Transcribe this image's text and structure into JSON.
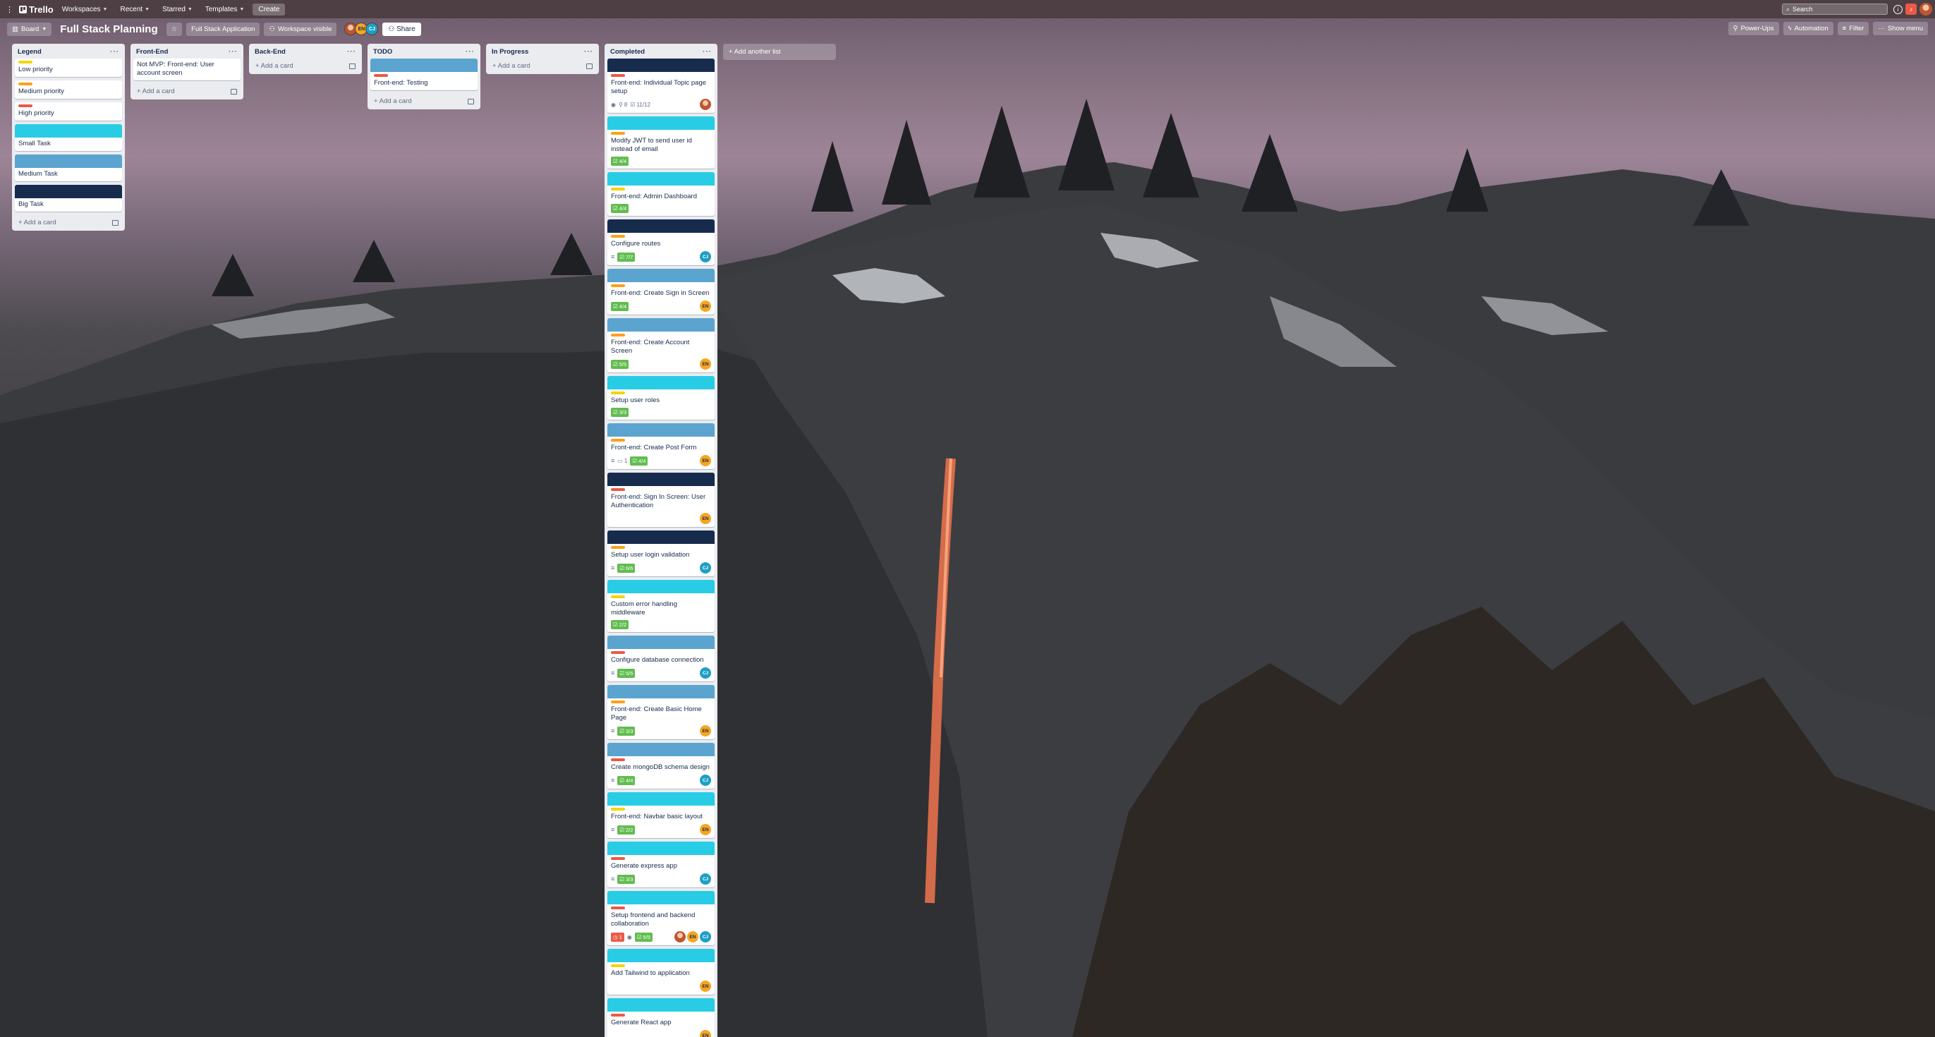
{
  "topbar": {
    "app_name": "Trello",
    "workspaces": "Workspaces",
    "recent": "Recent",
    "starred": "Starred",
    "templates": "Templates",
    "create": "Create",
    "search_placeholder": "Search"
  },
  "boardbar": {
    "view": "Board",
    "title": "Full Stack Planning",
    "workspace": "Full Stack Application",
    "visibility": "Workspace visible",
    "share": "Share",
    "power_ups": "Power-Ups",
    "automation": "Automation",
    "filter": "Filter",
    "show_menu": "Show menu",
    "members": [
      "photo",
      "EN",
      "CJ"
    ]
  },
  "colors": {
    "yellow": "#f2d600",
    "orange": "#ff9f1a",
    "red": "#eb5a46",
    "sky": "#29cce5",
    "blue": "#5ba4cf",
    "navy": "#172b4d",
    "green": "#61bd4f"
  },
  "add_card": "Add a card",
  "add_list": "Add another list",
  "lists": [
    {
      "name": "Legend",
      "cards": [
        {
          "label": "yellow",
          "title": "Low priority"
        },
        {
          "label": "orange",
          "title": "Medium priority"
        },
        {
          "label": "red",
          "title": "High priority"
        },
        {
          "cover": "sky",
          "title": "Small Task"
        },
        {
          "cover": "blue",
          "title": "Medium Task"
        },
        {
          "cover": "navy",
          "title": "Big Task"
        }
      ]
    },
    {
      "name": "Front-End",
      "cards": [
        {
          "title": "Not MVP: Front-end: User account screen"
        }
      ]
    },
    {
      "name": "Back-End",
      "cards": []
    },
    {
      "name": "TODO",
      "cards": [
        {
          "cover": "blue",
          "label": "red",
          "title": "Front-end: Testing"
        }
      ]
    },
    {
      "name": "In Progress",
      "cards": []
    },
    {
      "name": "Completed",
      "cards": [
        {
          "cover": "navy",
          "label": "red",
          "title": "Front-end: Individual Topic page setup",
          "watch": true,
          "attach": "8",
          "check": "11/12",
          "check_plain": true,
          "members": [
            "photo"
          ]
        },
        {
          "cover": "sky",
          "label": "orange",
          "title": "Modify JWT to send user id instead of email",
          "check": "4/4"
        },
        {
          "cover": "sky",
          "label": "yellow",
          "title": "Front-end: Admin Dashboard",
          "check": "4/4"
        },
        {
          "cover": "navy",
          "label": "orange",
          "title": "Configure routes",
          "desc": true,
          "check": "7/7",
          "members": [
            "CJ"
          ]
        },
        {
          "cover": "blue",
          "label": "orange",
          "title": "Front-end: Create Sign in Screen",
          "check": "4/4",
          "members": [
            "EN"
          ]
        },
        {
          "cover": "blue",
          "label": "orange",
          "title": "Front-end: Create Account Screen",
          "check": "5/5",
          "members": [
            "EN"
          ]
        },
        {
          "cover": "sky",
          "label": "yellow",
          "title": "Setup user roles",
          "check": "3/3"
        },
        {
          "cover": "blue",
          "label": "orange",
          "title": "Front-end: Create Post Form",
          "desc": true,
          "comments": "1",
          "check": "4/4",
          "members": [
            "EN"
          ]
        },
        {
          "cover": "navy",
          "label": "red",
          "title": "Front-end: Sign In Screen: User Authentication",
          "members": [
            "EN"
          ]
        },
        {
          "cover": "navy",
          "label": "orange",
          "title": "Setup user login validation",
          "desc": true,
          "check": "6/6",
          "members": [
            "CJ"
          ]
        },
        {
          "cover": "sky",
          "label": "yellow",
          "title": "Custom error handling middleware",
          "check": "2/2"
        },
        {
          "cover": "blue",
          "label": "red",
          "title": "Configure database connection",
          "desc": true,
          "check": "5/5",
          "members": [
            "CJ"
          ]
        },
        {
          "cover": "blue",
          "label": "orange",
          "title": "Front-end: Create Basic Home Page",
          "desc": true,
          "check": "3/3",
          "members": [
            "EN"
          ]
        },
        {
          "cover": "blue",
          "label": "red",
          "title": "Create mongoDB schema design",
          "desc": true,
          "check": "4/4",
          "members": [
            "CJ"
          ]
        },
        {
          "cover": "sky",
          "label": "yellow",
          "title": "Front-end: Navbar basic layout",
          "desc": true,
          "check": "2/2",
          "members": [
            "EN"
          ]
        },
        {
          "cover": "sky",
          "label": "red",
          "title": "Generate express app",
          "desc": true,
          "check": "3/3",
          "members": [
            "CJ"
          ]
        },
        {
          "cover": "sky",
          "label": "red",
          "title": "Setup frontend and backend collaboration",
          "due": "1",
          "watch": true,
          "check": "5/5",
          "members": [
            "photo",
            "EN",
            "CJ"
          ]
        },
        {
          "cover": "sky",
          "label": "yellow",
          "title": "Add Tailwind to application",
          "members": [
            "EN"
          ]
        },
        {
          "cover": "sky",
          "label": "red",
          "title": "Generate React app",
          "members": [
            "EN"
          ]
        }
      ]
    }
  ]
}
